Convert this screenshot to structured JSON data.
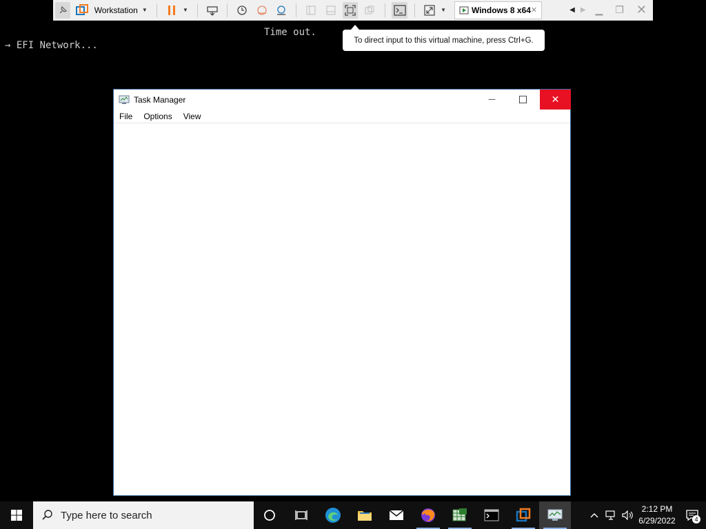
{
  "vm_toolbar": {
    "product_label": "Workstation",
    "tab_label": "Windows 8 x64",
    "tab_close": "✕",
    "tooltip": "To direct input to this virtual machine, press Ctrl+G."
  },
  "console": {
    "line1": "→ EFI Network...",
    "line2": "Time out."
  },
  "task_manager": {
    "title": "Task Manager",
    "menu": [
      "File",
      "Options",
      "View"
    ],
    "minimize": "—",
    "maximize": "☐",
    "close": "✕"
  },
  "taskbar": {
    "search_placeholder": "Type here to search",
    "apps": [
      "task-view",
      "edge",
      "file-explorer",
      "mail",
      "firefox",
      "excel-like",
      "terminal",
      "vmware",
      "task-manager"
    ],
    "clock_time": "2:12 PM",
    "clock_date": "6/29/2022",
    "notification_count": "4"
  },
  "colors": {
    "close_red": "#e81123",
    "vmware_blue": "#1b75bb",
    "vmware_orange": "#f57c20"
  }
}
